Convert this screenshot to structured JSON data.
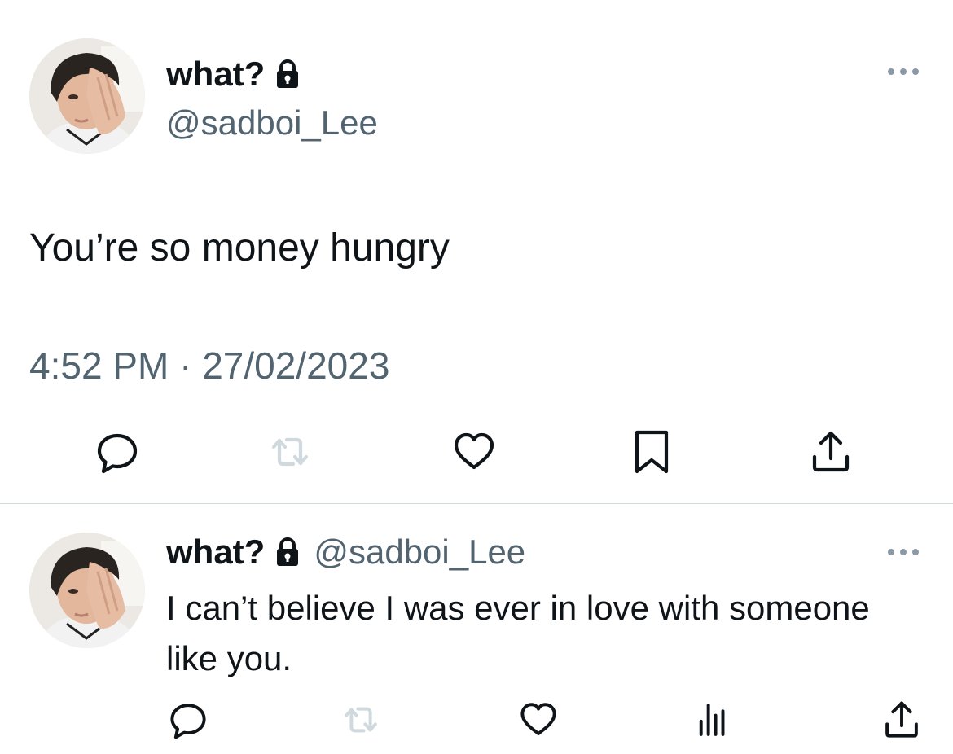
{
  "tweet": {
    "display_name": "what?",
    "handle": "@sadboi_Lee",
    "text": "You’re so money hungry",
    "timestamp": "4:52 PM · 27/02/2023",
    "actions": [
      "reply-icon",
      "retweet-icon",
      "like-icon",
      "bookmark-icon",
      "share-icon"
    ]
  },
  "reply": {
    "display_name": "what?",
    "handle": "@sadboi_Lee",
    "text": "I can’t believe I was ever in love with someone like you.",
    "actions": [
      "reply-icon",
      "retweet-icon",
      "like-icon",
      "views-icon",
      "share-icon"
    ]
  },
  "colors": {
    "text": "#0f1419",
    "secondary": "#536471",
    "divider": "#cfd9de",
    "retweet_disabled": "#cfd9de"
  }
}
